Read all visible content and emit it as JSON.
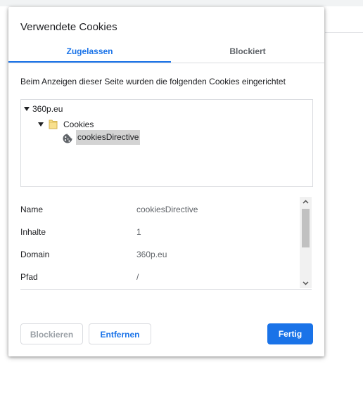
{
  "dialog": {
    "title": "Verwendete Cookies",
    "tabs": [
      {
        "label": "Zugelassen",
        "active": true
      },
      {
        "label": "Blockiert",
        "active": false
      }
    ],
    "description": "Beim Anzeigen dieser Seite wurden die folgenden Cookies eingerichtet",
    "tree": {
      "site": "360p.eu",
      "folder": "Cookies",
      "cookie": "cookiesDirective",
      "site_icon": "triangle-down-icon",
      "folder_icon": "folder-icon",
      "cookie_icon": "cookie-icon"
    },
    "details": [
      {
        "key": "Name",
        "value": "cookiesDirective"
      },
      {
        "key": "Inhalte",
        "value": "1"
      },
      {
        "key": "Domain",
        "value": "360p.eu"
      },
      {
        "key": "Pfad",
        "value": "/"
      }
    ],
    "buttons": {
      "block": "Blockieren",
      "remove": "Entfernen",
      "done": "Fertig"
    },
    "colors": {
      "accent": "#1a73e8",
      "selection": "#d3d3d3",
      "folder": "#f5d76e"
    }
  }
}
